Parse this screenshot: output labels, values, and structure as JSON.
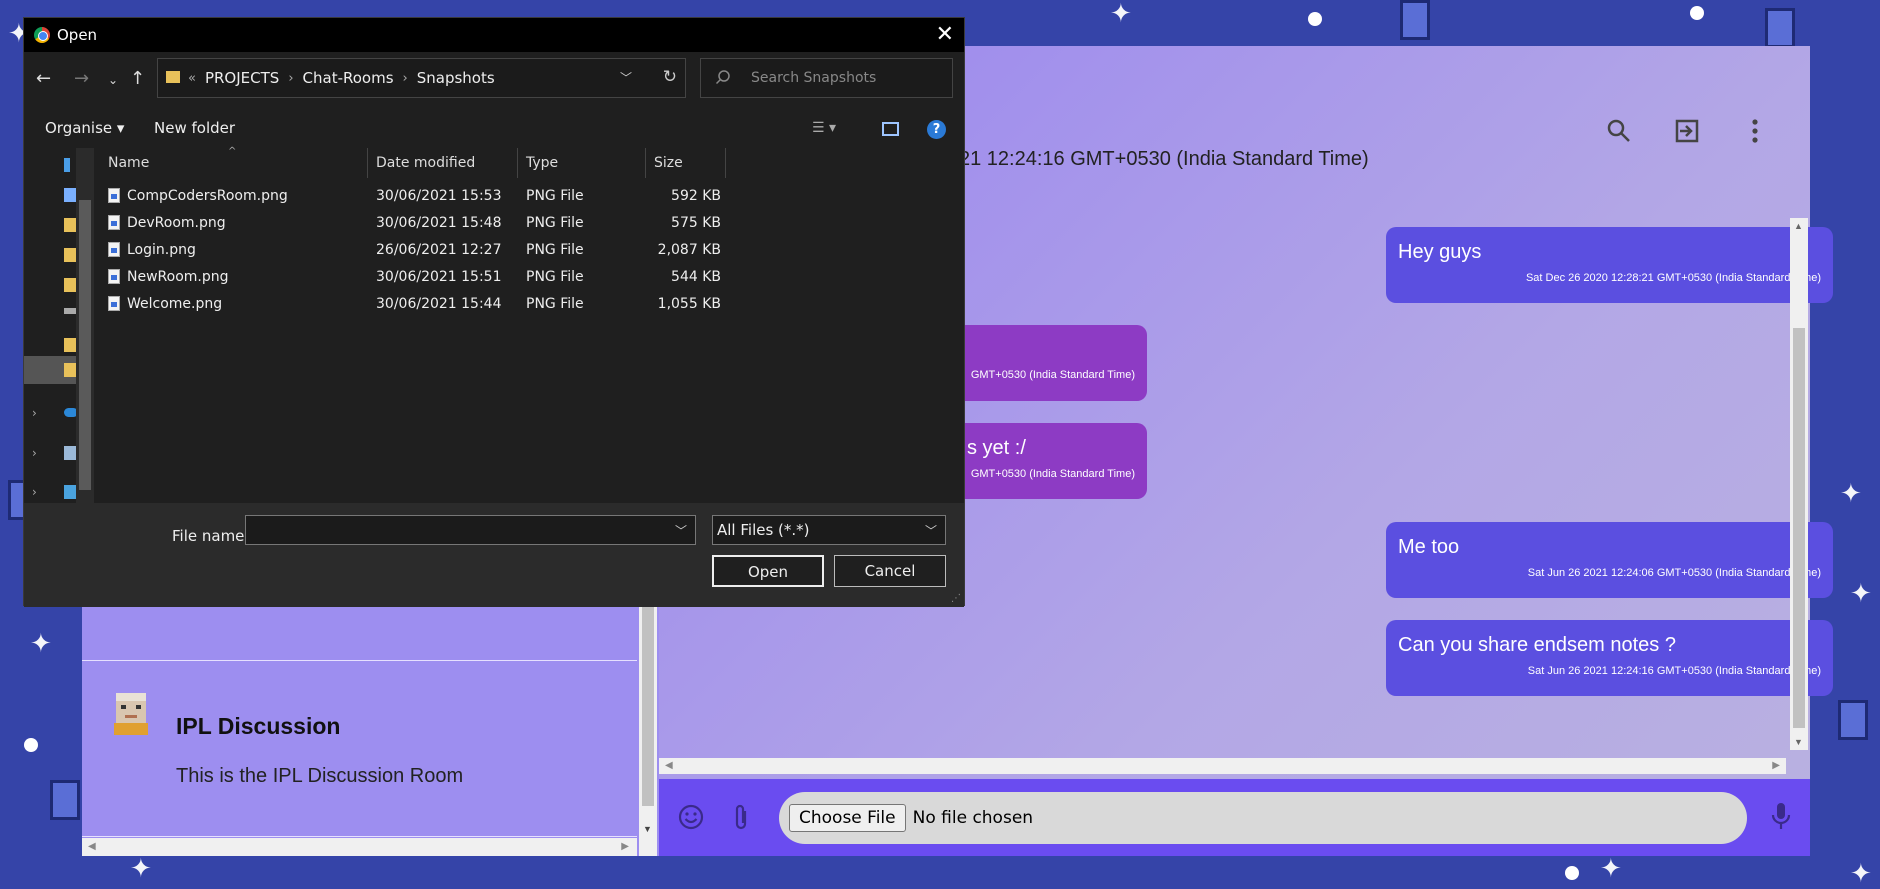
{
  "dialog": {
    "title": "Open",
    "close_glyph": "✕",
    "breadcrumb": {
      "overflow": "«",
      "items": [
        "PROJECTS",
        "Chat-Rooms",
        "Snapshots"
      ]
    },
    "search_placeholder": "Search Snapshots",
    "toolbar": {
      "organise": "Organise ▾",
      "new_folder": "New folder",
      "help": "?"
    },
    "columns": [
      "Name",
      "Date modified",
      "Type",
      "Size"
    ],
    "files": [
      {
        "name": "CompCodersRoom.png",
        "date": "30/06/2021 15:53",
        "type": "PNG File",
        "size": "592 KB"
      },
      {
        "name": "DevRoom.png",
        "date": "30/06/2021 15:48",
        "type": "PNG File",
        "size": "575 KB"
      },
      {
        "name": "Login.png",
        "date": "26/06/2021 12:27",
        "type": "PNG File",
        "size": "2,087 KB"
      },
      {
        "name": "NewRoom.png",
        "date": "30/06/2021 15:51",
        "type": "PNG File",
        "size": "544 KB"
      },
      {
        "name": "Welcome.png",
        "date": "30/06/2021 15:44",
        "type": "PNG File",
        "size": "1,055 KB"
      }
    ],
    "file_name_label": "File name:",
    "file_name_value": "",
    "filter": "All Files (*.*)",
    "open_button": "Open",
    "cancel_button": "Cancel"
  },
  "chat": {
    "header_time_partial": "21 12:24:16 GMT+0530 (India Standard Time)",
    "messages": [
      {
        "side": "right",
        "text": "Hey guys",
        "time": "Sat Dec 26 2020 12:28:21 GMT+0530 (India Standard Time)"
      },
      {
        "side": "left",
        "text": "",
        "time": "GMT+0530 (India Standard Time)"
      },
      {
        "side": "left",
        "text": "s yet :/",
        "time": "GMT+0530 (India Standard Time)"
      },
      {
        "side": "right",
        "text": "Me too",
        "time": "Sat Jun 26 2021 12:24:06 GMT+0530 (India Standard Time)"
      },
      {
        "side": "right",
        "text": "Can you share endsem notes ?",
        "time": "Sat Jun 26 2021 12:24:16 GMT+0530 (India Standard Time)"
      }
    ],
    "composer": {
      "choose_file": "Choose File",
      "no_file": "No file chosen"
    }
  },
  "sidebar": {
    "rooms": [
      {
        "title": "IPL Discussion",
        "description": "This is the IPL Discussion Room"
      }
    ]
  },
  "colors": {
    "own_message": "#5b4fe0",
    "other_message": "#8d3bc4",
    "composer": "#6a4cf0",
    "sidebar": "#9d8ef0"
  }
}
